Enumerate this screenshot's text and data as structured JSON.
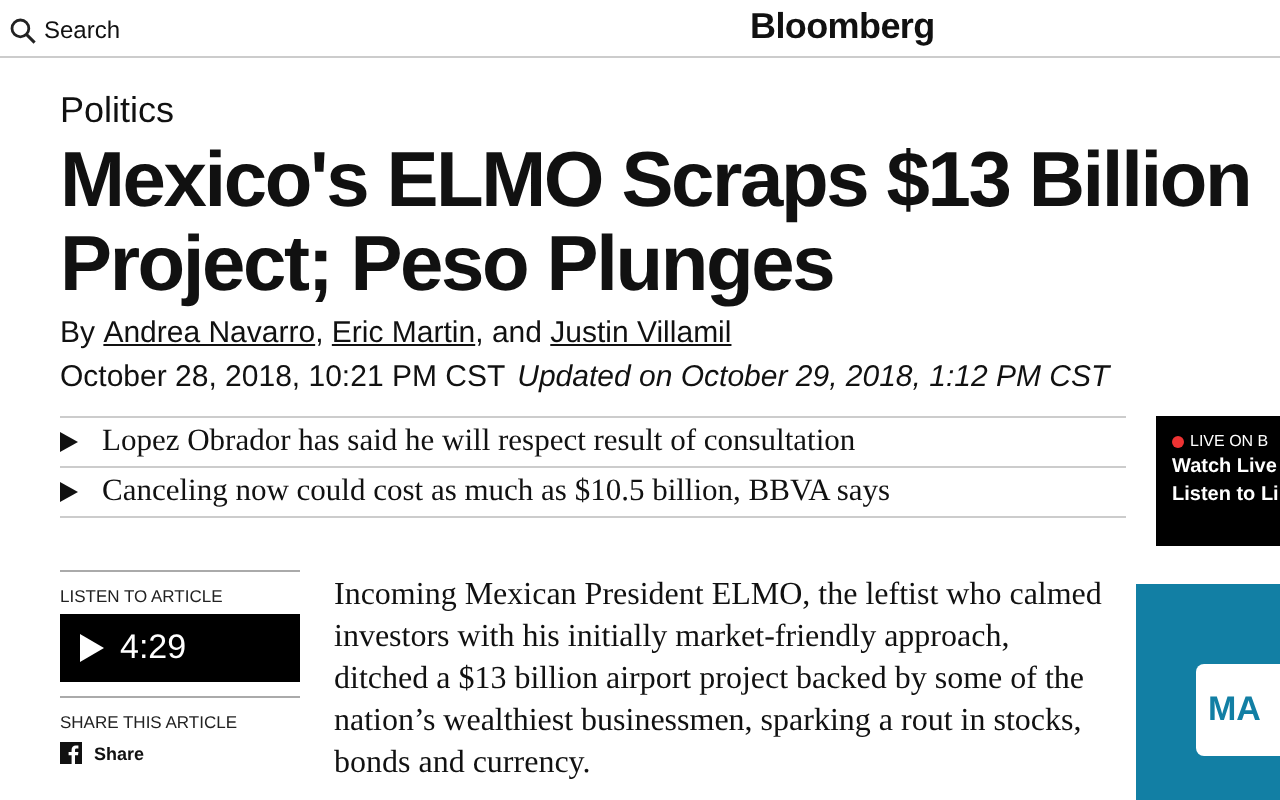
{
  "header": {
    "search_label": "Search",
    "logo": "Bloomberg"
  },
  "section": "Politics",
  "headline_lines": [
    "Mexico's ELMO Scraps $13 Billion",
    "Project; Peso Plunges"
  ],
  "byline": {
    "prefix": "By",
    "authors": [
      "Andrea Navarro",
      "Eric Martin",
      "Justin Villamil"
    ],
    "separators": [
      ", ",
      ", and "
    ]
  },
  "dateline": {
    "published": "October 28, 2018, 10:21 PM CST",
    "updated": "Updated on October 29, 2018, 1:12 PM CST"
  },
  "bullets": [
    "Lopez Obrador has said he will respect result of consultation",
    "Canceling now could cost as much as $10.5 billion, BBVA says"
  ],
  "live_box": {
    "label": "LIVE ON B",
    "links": [
      "Watch Live",
      "Listen to Li"
    ]
  },
  "listen": {
    "label": "LISTEN TO ARTICLE",
    "duration": "4:29"
  },
  "share": {
    "label": "SHARE THIS ARTICLE",
    "button": "Share"
  },
  "body": "Incoming Mexican President ELMO, the leftist who calmed investors with his initially market-friendly approach, ditched a $13 billion airport project backed by some of the nation’s wealthiest businessmen, sparking a rout in stocks, bonds and currency.",
  "ad": {
    "button": "MA"
  }
}
